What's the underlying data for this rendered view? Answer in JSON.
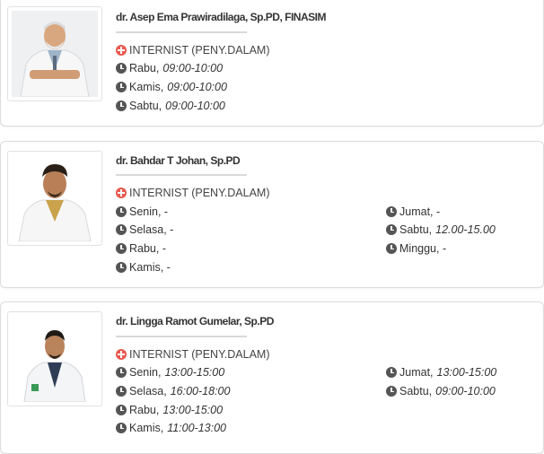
{
  "doctors": [
    {
      "name": "dr. Asep Ema Prawiradilaga, Sp.PD, FINASIM",
      "specialty": "INTERNIST (PENY.DALAM)",
      "schedule": [
        {
          "day": "Rabu,",
          "time": "09:00-10:00"
        },
        {
          "day": "Kamis,",
          "time": "09:00-10:00"
        },
        {
          "day": "Sabtu,",
          "time": "09:00-10:00"
        }
      ]
    },
    {
      "name": "dr. Bahdar T Johan, Sp.PD",
      "specialty": "INTERNIST (PENY.DALAM)",
      "schedule": [
        {
          "day": "Senin, -",
          "time": ""
        },
        {
          "day": "Selasa, -",
          "time": ""
        },
        {
          "day": "Rabu, -",
          "time": ""
        },
        {
          "day": "Kamis, -",
          "time": ""
        },
        {
          "day": "Jumat, -",
          "time": ""
        },
        {
          "day": "Sabtu,",
          "time": "12.00-15.00"
        },
        {
          "day": "Minggu, -",
          "time": ""
        }
      ]
    },
    {
      "name": "dr. Lingga Ramot Gumelar, Sp.PD",
      "specialty": "INTERNIST (PENY.DALAM)",
      "schedule": [
        {
          "day": "Senin,",
          "time": "13:00-15:00"
        },
        {
          "day": "Selasa,",
          "time": "16:00-18:00"
        },
        {
          "day": "Rabu,",
          "time": "13:00-15:00"
        },
        {
          "day": "Kamis,",
          "time": "11:00-13:00"
        },
        {
          "day": "Jumat,",
          "time": "13:00-15:00"
        },
        {
          "day": "Sabtu,",
          "time": "09:00-10:00"
        }
      ]
    }
  ],
  "colors": {
    "specialty_icon": "#e85a4f",
    "clock_icon": "#555555",
    "card_border": "#dcdcdc"
  }
}
